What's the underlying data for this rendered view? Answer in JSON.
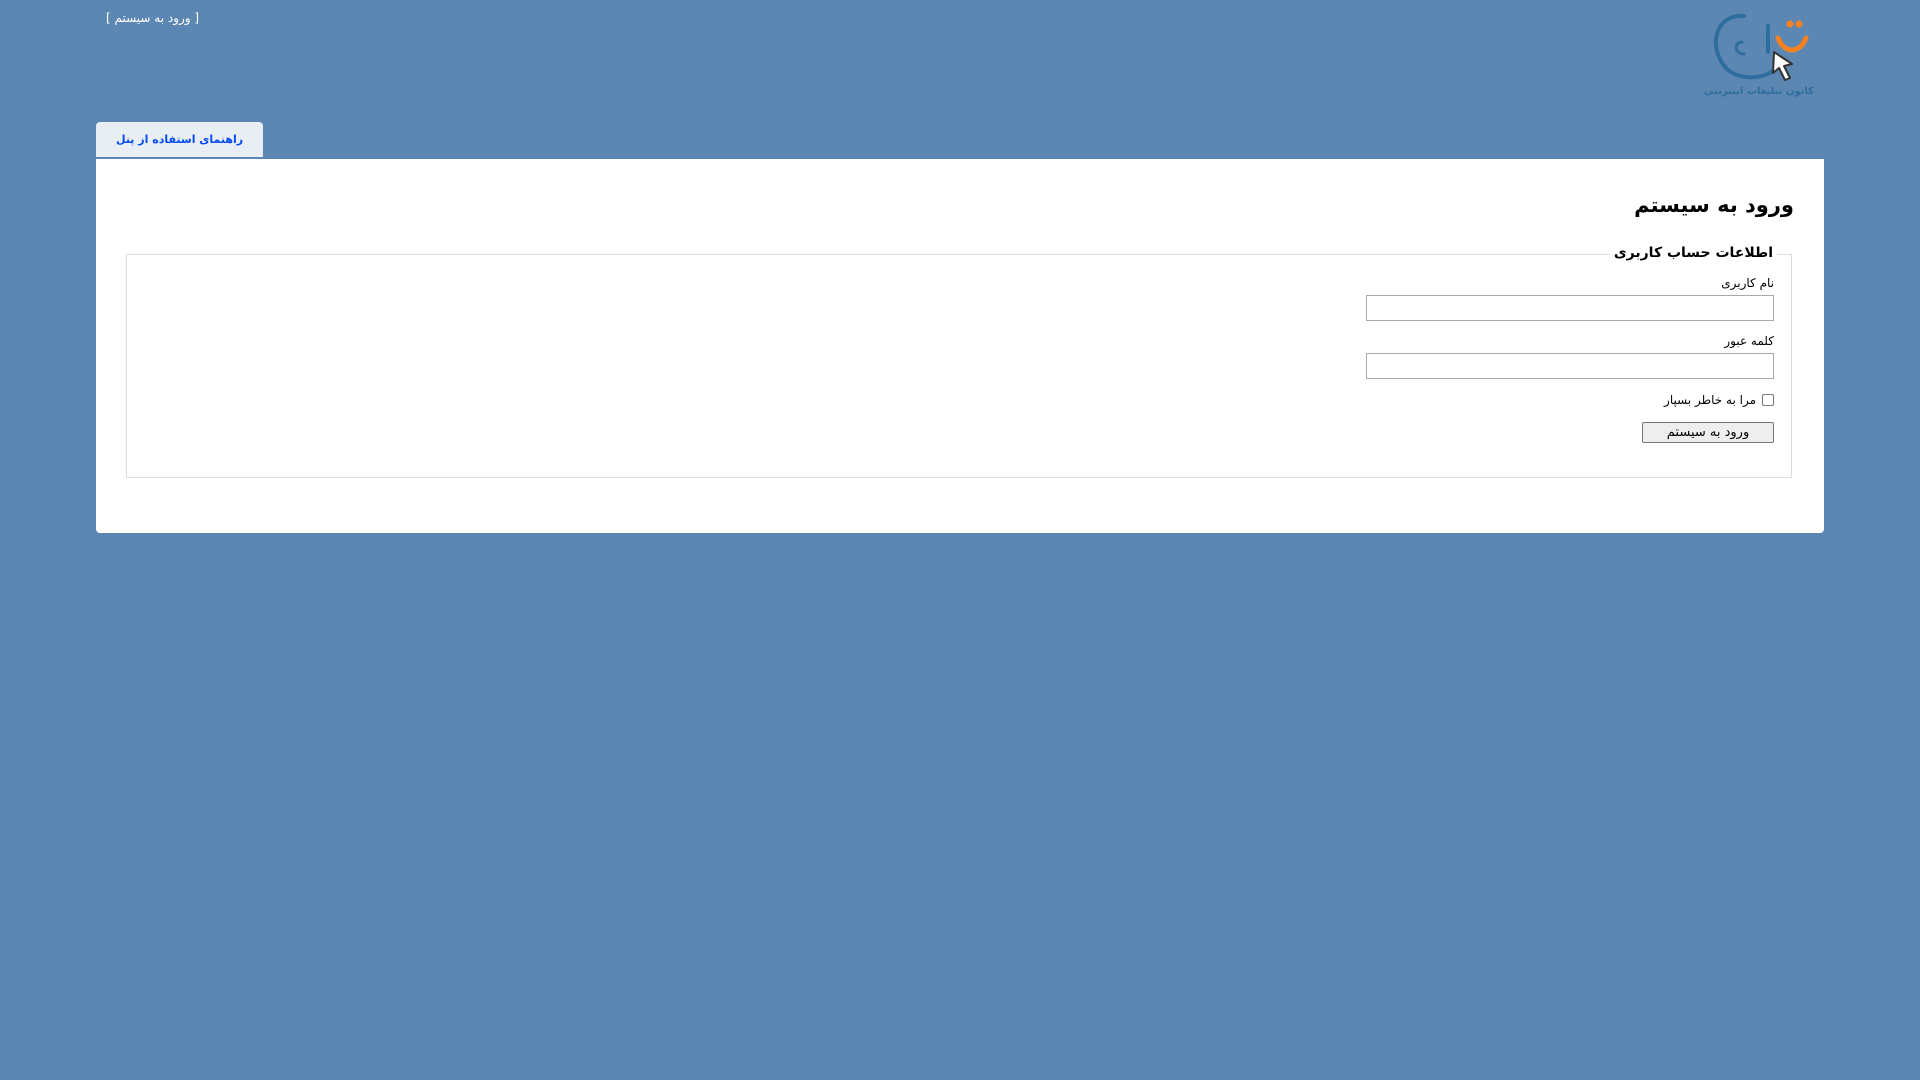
{
  "header": {
    "login_display": "[ ورود به سیستم ]",
    "logo": {
      "icon": "logo-mark",
      "caption": "کانون تبلیغات اینترنتی"
    }
  },
  "tabs": [
    {
      "label": "راهنمای استفاده از پنل"
    }
  ],
  "main": {
    "title": "ورود به سیستم",
    "fieldset": {
      "legend": "اطلاعات حساب کاربری",
      "username": {
        "label": "نام کاربری",
        "value": "",
        "placeholder": ""
      },
      "password": {
        "label": "کلمه عبور",
        "value": "",
        "placeholder": ""
      },
      "remember_me": {
        "label": "مرا به خاطر بسپار",
        "checked": false
      },
      "submit_label": "ورود به سیستم"
    }
  },
  "colors": {
    "background": "#5c87b2",
    "tab_background": "#e8eef4",
    "tab_text": "#034af3",
    "logo_blue": "#2e6e9e",
    "logo_orange": "#f58220"
  }
}
